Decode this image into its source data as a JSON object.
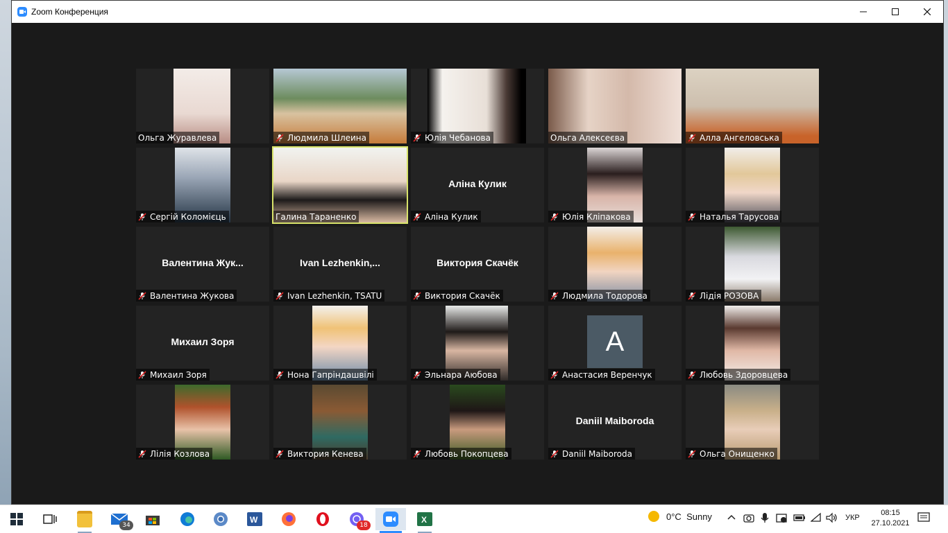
{
  "window": {
    "title": "Zoom Конференция"
  },
  "participants": [
    {
      "name": "Ольга Журавлева",
      "video": "photo",
      "muted": false
    },
    {
      "name": "Людмила Шлеина",
      "video": "photo",
      "muted": true
    },
    {
      "name": "Юлія Чебанова",
      "video": "photo",
      "muted": true
    },
    {
      "name": "Ольга Алексеєва",
      "video": "photo",
      "muted": false
    },
    {
      "name": "Алла Ангеловська",
      "video": "photo",
      "muted": true
    },
    {
      "name": "Сергій Коломієць",
      "video": "photo",
      "muted": true
    },
    {
      "name": "Галина Тараненко",
      "video": "photo",
      "muted": false,
      "active_speaker": true
    },
    {
      "name": "Аліна Кулик",
      "video": "none",
      "display_name": "Аліна Кулик",
      "muted": true
    },
    {
      "name": "Юлія Кліпакова",
      "video": "photo",
      "muted": true
    },
    {
      "name": "Наталья Тарусова",
      "video": "photo",
      "muted": true
    },
    {
      "name": "Валентина Жукова",
      "video": "none",
      "display_name": "Валентина  Жук...",
      "muted": true
    },
    {
      "name": "Ivan Lezhenkin, TSATU",
      "video": "none",
      "display_name": "Ivan  Lezhenkin,...",
      "muted": true
    },
    {
      "name": "Виктория Скачёк",
      "video": "none",
      "display_name": "Виктория Скачёк",
      "muted": true
    },
    {
      "name": "Людмила Тодорова",
      "video": "photo",
      "muted": true
    },
    {
      "name": "Лідія РОЗОВА",
      "video": "photo",
      "muted": true
    },
    {
      "name": "Михаил Зоря",
      "video": "none",
      "display_name": "Михаил Зоря",
      "muted": true
    },
    {
      "name": "Нона Гапріндашвілі",
      "video": "photo",
      "muted": true
    },
    {
      "name": "Эльнара Аюбова",
      "video": "photo",
      "muted": true
    },
    {
      "name": "Анастасия Веренчук",
      "video": "letter",
      "letter": "A",
      "muted": true
    },
    {
      "name": "Любовь Здоровцева",
      "video": "photo",
      "muted": true
    },
    {
      "name": "Лілія Козлова",
      "video": "photo",
      "muted": true
    },
    {
      "name": "Виктория Кенева",
      "video": "photo",
      "muted": true
    },
    {
      "name": "Любовь Покопцева",
      "video": "photo",
      "muted": true
    },
    {
      "name": "Daniil Maiboroda",
      "video": "none",
      "display_name": "Daniil Maiboroda",
      "muted": true
    },
    {
      "name": "Ольга Онищенко",
      "video": "photo",
      "muted": true
    }
  ],
  "taskbar": {
    "apps": [
      {
        "icon": "windows-start-icon"
      },
      {
        "icon": "task-view-icon"
      },
      {
        "icon": "file-explorer-icon"
      },
      {
        "icon": "mail-icon",
        "badge": "34"
      },
      {
        "icon": "store-icon"
      },
      {
        "icon": "edge-icon"
      },
      {
        "icon": "chrome-icon"
      },
      {
        "icon": "word-icon"
      },
      {
        "icon": "firefox-icon"
      },
      {
        "icon": "opera-icon"
      },
      {
        "icon": "viber-icon",
        "badge": "18"
      },
      {
        "icon": "zoom-icon"
      },
      {
        "icon": "excel-icon"
      }
    ],
    "weather": {
      "temp": "0°C",
      "condition": "Sunny"
    },
    "language": "УКР",
    "time": "08:15",
    "date": "27.10.2021"
  },
  "colors": {
    "zoom_blue": "#2D8CFF",
    "active_speaker": "#d8e36a",
    "mute_red": "#e02828"
  }
}
